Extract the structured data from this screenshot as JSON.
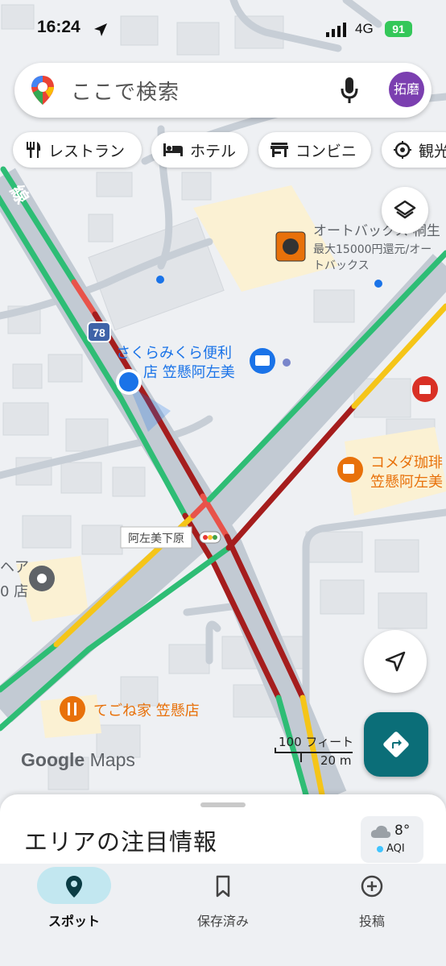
{
  "status_bar": {
    "time": "16:24",
    "network": "4G",
    "battery": "91"
  },
  "search": {
    "placeholder": "ここで検索",
    "avatar_text": "拓磨"
  },
  "chips": [
    {
      "label": "レストラン",
      "icon": "restaurant-icon"
    },
    {
      "label": "ホテル",
      "icon": "hotel-icon"
    },
    {
      "label": "コンビニ",
      "icon": "store-icon"
    },
    {
      "label": "観光",
      "icon": "attraction-icon"
    }
  ],
  "map": {
    "road_label": "線",
    "route_shield": "78",
    "places": [
      {
        "name": "オートバックス 桐生",
        "line2": "最大15000円還元/オー",
        "line3": "トバックス",
        "color": "#5f6368"
      },
      {
        "name": "さくらみくら便利",
        "line2": "店 笠懸阿左美",
        "color": "#1a73e8"
      },
      {
        "name": "コメダ珈琲",
        "line2": "笠懸阿左美",
        "color": "#e8710a"
      },
      {
        "name": "てごね家 笠懸店",
        "color": "#e8710a"
      },
      {
        "name": "ヘア",
        "line2": "0 店",
        "color": "#5f6368"
      }
    ],
    "intersection_label": "阿左美下原",
    "scale_feet": "100 フィート",
    "scale_meters": "20 m",
    "attribution_google": "Google",
    "attribution_maps": "Maps"
  },
  "sheet": {
    "title": "エリアの注目情報"
  },
  "weather": {
    "temperature": "8°",
    "aqi_label": "AQI"
  },
  "bottom_nav": [
    {
      "label": "スポット",
      "icon": "location-pin-icon",
      "active": true
    },
    {
      "label": "保存済み",
      "icon": "bookmark-icon",
      "active": false
    },
    {
      "label": "投稿",
      "icon": "add-circle-icon",
      "active": false
    }
  ],
  "colors": {
    "accent": "#0b6e78",
    "traffic_green": "#2ebd75",
    "traffic_red": "#a51d1d",
    "traffic_yellow": "#f5c518",
    "location_blue": "#1a73e8"
  }
}
